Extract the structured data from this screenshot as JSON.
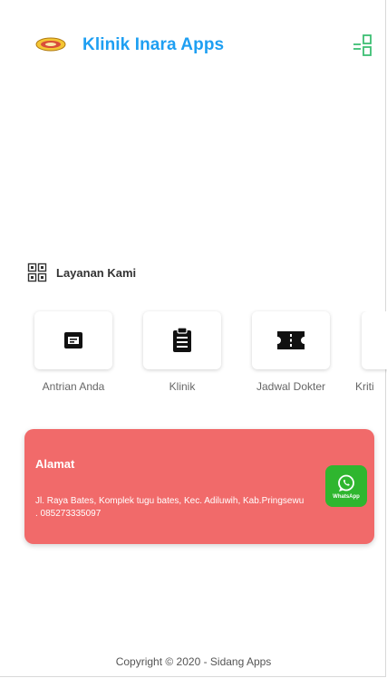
{
  "header": {
    "title": "Klinik Inara Apps",
    "logo_icon": "clinic-logo-icon",
    "menu_icon": "grid-menu-icon"
  },
  "services_section": {
    "title": "Layanan Kami",
    "icon": "services-grid-icon",
    "items": [
      {
        "label": "Antrian Anda",
        "icon": "queue-ticket-icon"
      },
      {
        "label": "Klinik",
        "icon": "clipboard-icon"
      },
      {
        "label": "Jadwal Dokter",
        "icon": "ticket-schedule-icon"
      },
      {
        "label": "Kriti",
        "icon": "unknown-icon"
      }
    ]
  },
  "address_card": {
    "heading": "Alamat",
    "text": "Jl. Raya Bates, Komplek tugu bates, Kec. Adiluwih, Kab.Pringsewu . 085273335097",
    "whatsapp_label": "WhatsApp",
    "whatsapp_icon": "whatsapp-icon",
    "background": "#f16a6a"
  },
  "footer": {
    "copyright": "Copyright © 2020 - Sidang Apps"
  },
  "colors": {
    "accent": "#1e9ff2",
    "card_red": "#f16a6a",
    "whatsapp_green": "#2fb62f"
  }
}
